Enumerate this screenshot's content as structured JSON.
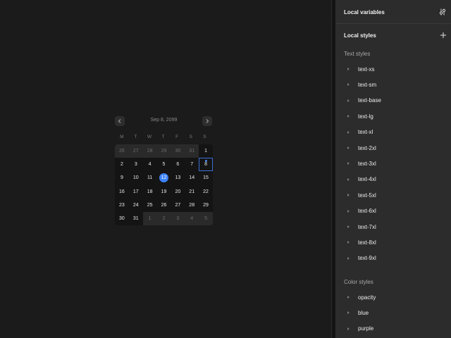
{
  "calendar": {
    "title": "Sep 8, 2099",
    "weekdays": [
      "M",
      "T",
      "W",
      "T",
      "F",
      "S",
      "S"
    ],
    "weeks": [
      [
        "26",
        "27",
        "28",
        "29",
        "30",
        "31",
        "1"
      ],
      [
        "2",
        "3",
        "4",
        "5",
        "6",
        "7",
        "8"
      ],
      [
        "9",
        "10",
        "11",
        "12",
        "13",
        "14",
        "15"
      ],
      [
        "16",
        "17",
        "18",
        "19",
        "20",
        "21",
        "22"
      ],
      [
        "23",
        "24",
        "25",
        "26",
        "27",
        "28",
        "29"
      ],
      [
        "30",
        "31",
        "1",
        "2",
        "3",
        "4",
        "5"
      ]
    ],
    "selected_day": "12",
    "today_day": "8",
    "prev_icon": "chevron-left-icon",
    "next_icon": "chevron-right-icon",
    "accent_color": "#3b82f6"
  },
  "panel": {
    "local_variables": {
      "label": "Local variables",
      "icon": "sliders-icon"
    },
    "local_styles": {
      "label": "Local styles",
      "icon": "plus-icon"
    },
    "text_styles": {
      "label": "Text styles",
      "items": [
        "text-xs",
        "text-sm",
        "text-base",
        "text-lg",
        "text-xl",
        "text-2xl",
        "text-3xl",
        "text-4xl",
        "text-5xl",
        "text-6xl",
        "text-7xl",
        "text-8xl",
        "text-9xl"
      ]
    },
    "color_styles": {
      "label": "Color styles",
      "items": [
        "opacity",
        "blue",
        "purple"
      ]
    }
  }
}
